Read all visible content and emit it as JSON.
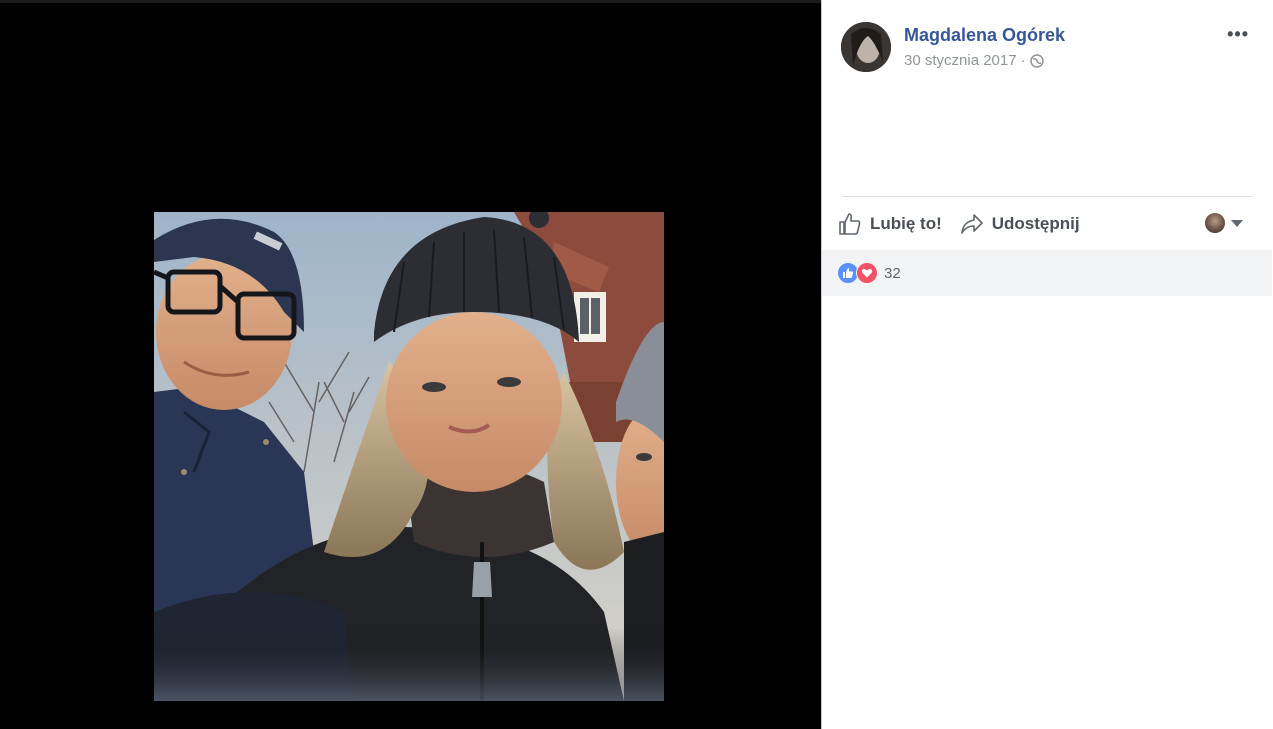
{
  "post": {
    "author": "Magdalena Ogórek",
    "date": "30 stycznia 2017",
    "separator": "·"
  },
  "header": {
    "more_label": "•••"
  },
  "actions": {
    "like_label": "Lubię to!",
    "share_label": "Udostępnij"
  },
  "reactions": {
    "count": "32",
    "types": [
      "like-icon",
      "love-icon"
    ]
  },
  "colors": {
    "name_link": "#365899",
    "like_blue": "#5890ff",
    "love_red": "#f25268",
    "reaction_bar": "#f2f3f5"
  }
}
